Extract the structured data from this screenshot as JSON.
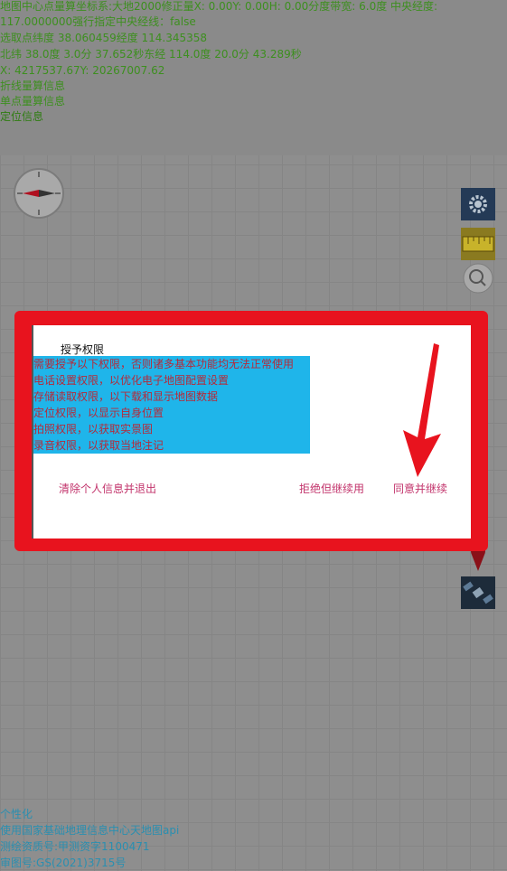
{
  "info": {
    "line1": "地图中心点量算坐标系:大地2000修正量X:   0.00Y:   0.00H:   0.00分度带宽:   6.0度 中央经度:",
    "line2": "117.0000000强行指定中央经线：false",
    "line3": "选取点纬度 38.060459经度 114.345358",
    "line4": "北纬 38.0度 3.0分 37.652秒东经 114.0度 20.0分 43.289秒",
    "line5": "X:   4217537.67Y:   20267007.62",
    "polyline_measure": "折线量算信息",
    "point_measure": "单点量算信息",
    "location_info": "定位信息"
  },
  "toolbar": {
    "icons": [
      "gear-icon",
      "ruler-icon",
      "magnifier-icon",
      "layers-icon",
      "pin-icon",
      "satellite-icon"
    ]
  },
  "dialog": {
    "title": "授予权限",
    "permissions": [
      "需要授予以下权限，否则诸多基本功能均无法正常使用",
      "电话设置权限，以优化电子地图配置设置",
      "存储读取权限，以下载和显示地图数据",
      "定位权限，以显示自身位置",
      "拍照权限，以获取实景图",
      "录音权限，以获取当地注记"
    ],
    "clear_exit": "清除个人信息并退出",
    "refuse_continue": "拒绝但继续用",
    "agree_continue": "同意并继续"
  },
  "footer": {
    "personalize": "个性化",
    "api_credit": "使用国家基础地理信息中心天地图api",
    "survey_license": "测绘资质号:甲测资字1100471",
    "map_number": "审图号:GS(2021)3715号"
  },
  "colors": {
    "annotation_red": "#e8131e",
    "permission_bg": "#1fb5ea",
    "button_text": "#c2336b",
    "info_text": "#3d8f1f"
  }
}
